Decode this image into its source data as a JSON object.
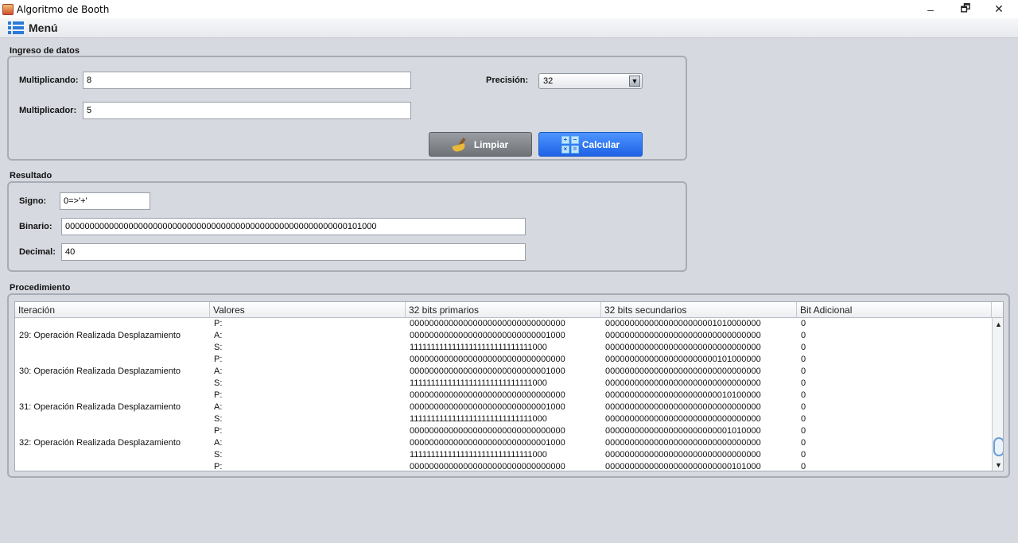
{
  "window": {
    "title": "Algoritmo de Booth",
    "minimize": "–",
    "maximize": "🗗",
    "close": "✕"
  },
  "menu": {
    "label": "Menú"
  },
  "ingreso": {
    "section_title": "Ingreso de datos",
    "multiplicando_label": "Multiplicando:",
    "multiplicando_value": "8",
    "multiplicador_label": "Multiplicador:",
    "multiplicador_value": "5",
    "precision_label": "Precisión:",
    "precision_value": "32",
    "limpiar_label": "Limpiar",
    "calcular_label": "Calcular"
  },
  "resultado": {
    "section_title": "Resultado",
    "signo_label": "Signo:",
    "signo_value": "0=>'+'",
    "binario_label": "Binario:",
    "binario_value": "0000000000000000000000000000000000000000000000000000000000101000",
    "decimal_label": "Decimal:",
    "decimal_value": "40"
  },
  "procedimiento": {
    "section_title": "Procedimiento",
    "columns": [
      "Iteración",
      "Valores",
      "32 bits primarios",
      "32 bits secundarios",
      "Bit Adicional"
    ],
    "rows": [
      [
        "",
        "P:",
        "00000000000000000000000000000000",
        "00000000000000000000001010000000",
        "0"
      ],
      [
        "29: Operación Realizada Desplazamiento",
        "A:",
        "00000000000000000000000000001000",
        "00000000000000000000000000000000",
        "0"
      ],
      [
        "",
        "S:",
        "11111111111111111111111111111000",
        "00000000000000000000000000000000",
        "0"
      ],
      [
        "",
        "P:",
        "00000000000000000000000000000000",
        "00000000000000000000000101000000",
        "0"
      ],
      [
        "30: Operación Realizada Desplazamiento",
        "A:",
        "00000000000000000000000000001000",
        "00000000000000000000000000000000",
        "0"
      ],
      [
        "",
        "S:",
        "11111111111111111111111111111000",
        "00000000000000000000000000000000",
        "0"
      ],
      [
        "",
        "P:",
        "00000000000000000000000000000000",
        "00000000000000000000000010100000",
        "0"
      ],
      [
        "31: Operación Realizada Desplazamiento",
        "A:",
        "00000000000000000000000000001000",
        "00000000000000000000000000000000",
        "0"
      ],
      [
        "",
        "S:",
        "11111111111111111111111111111000",
        "00000000000000000000000000000000",
        "0"
      ],
      [
        "",
        "P:",
        "00000000000000000000000000000000",
        "00000000000000000000000001010000",
        "0"
      ],
      [
        "32: Operación Realizada Desplazamiento",
        "A:",
        "00000000000000000000000000001000",
        "00000000000000000000000000000000",
        "0"
      ],
      [
        "",
        "S:",
        "11111111111111111111111111111000",
        "00000000000000000000000000000000",
        "0"
      ],
      [
        "",
        "P:",
        "00000000000000000000000000000000",
        "00000000000000000000000000101000",
        "0"
      ]
    ]
  },
  "colors": {
    "background": "#d6d9df",
    "calcular_button": "#2f74f2",
    "limpiar_button": "#85898e"
  }
}
